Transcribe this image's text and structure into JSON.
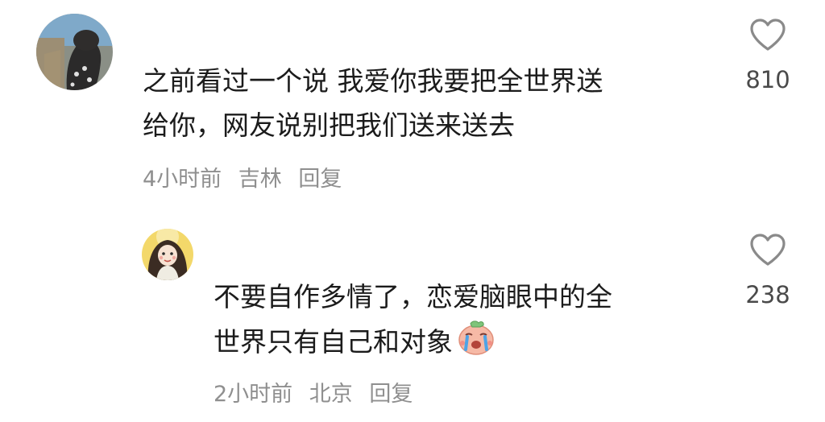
{
  "comments": [
    {
      "avatar_icon": "user-avatar-icon",
      "text_lines": [
        "之前看过一个说 我爱你我要把全世界送",
        "给你，网友说别把我们送来送去"
      ],
      "time": "4小时前",
      "location": "吉林",
      "reply_label": "回复",
      "likes": "810",
      "like_icon": "heart-outline-icon"
    },
    {
      "avatar_icon": "user-avatar-icon",
      "text_lines": [
        "不要自作多情了，恋爱脑眼中的全",
        "世界只有自己和对象"
      ],
      "emoji_icon": "crying-face-emoji-icon",
      "time": "2小时前",
      "location": "北京",
      "reply_label": "回复",
      "likes": "238",
      "like_icon": "heart-outline-icon"
    }
  ]
}
